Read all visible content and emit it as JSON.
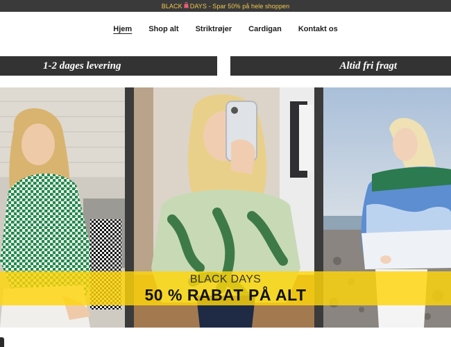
{
  "announcement": {
    "prefix": "BLACK",
    "icon": "shopping-bag-icon",
    "suffix": "DAYS - Spar 50% på hele shoppen"
  },
  "nav": {
    "items": [
      {
        "label": "Hjem",
        "active": true
      },
      {
        "label": "Shop alt"
      },
      {
        "label": "Striktrøjer"
      },
      {
        "label": "Cardigan"
      },
      {
        "label": "Kontakt os"
      }
    ]
  },
  "banners": {
    "left": "1-2 dages levering",
    "right": "Altid fri fragt"
  },
  "promo": {
    "line1": "BLACK DAYS",
    "line2": "50 % RABAT PÅ ALT"
  },
  "colors": {
    "accent": "#FFD60A",
    "announce_bg": "#3A3A3A",
    "banner_bg": "#333333"
  }
}
